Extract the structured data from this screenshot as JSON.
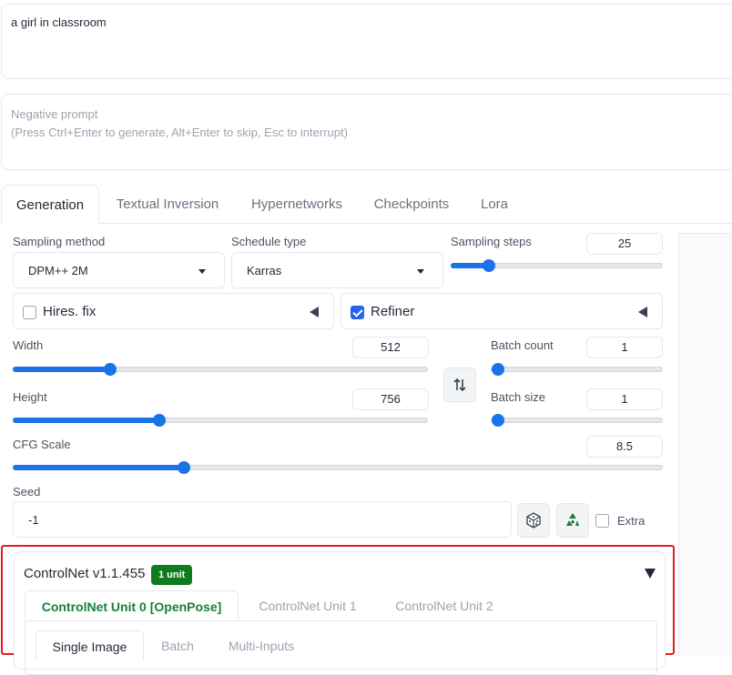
{
  "prompt": {
    "value": "a girl in classroom"
  },
  "negative_prompt": {
    "placeholder_line1": "Negative prompt",
    "placeholder_line2": "(Press Ctrl+Enter to generate, Alt+Enter to skip, Esc to interrupt)"
  },
  "tabs": [
    "Generation",
    "Textual Inversion",
    "Hypernetworks",
    "Checkpoints",
    "Lora"
  ],
  "sampling": {
    "method_label": "Sampling method",
    "method_value": "DPM++ 2M",
    "schedule_label": "Schedule type",
    "schedule_value": "Karras",
    "steps_label": "Sampling steps",
    "steps_value": "25",
    "steps_min": 1,
    "steps_max": 150
  },
  "hires": {
    "label": "Hires. fix",
    "checked": false
  },
  "refiner": {
    "label": "Refiner",
    "checked": true
  },
  "width": {
    "label": "Width",
    "value": "512",
    "min": 64,
    "max": 2048
  },
  "height": {
    "label": "Height",
    "value": "756",
    "min": 64,
    "max": 2048
  },
  "batch_count": {
    "label": "Batch count",
    "value": "1"
  },
  "batch_size": {
    "label": "Batch size",
    "value": "1"
  },
  "cfg": {
    "label": "CFG Scale",
    "value": "8.5",
    "min": 1,
    "max": 30
  },
  "seed": {
    "label": "Seed",
    "value": "-1",
    "extra_label": "Extra"
  },
  "controlnet": {
    "title": "ControlNet v1.1.455",
    "badge": "1 unit",
    "unit_tabs": [
      "ControlNet Unit 0 [OpenPose]",
      "ControlNet Unit 1",
      "ControlNet Unit 2"
    ],
    "input_tabs": [
      "Single Image",
      "Batch",
      "Multi-Inputs"
    ]
  },
  "colors": {
    "accent": "#1a73e8",
    "badge_bg": "#0f7a1f",
    "highlight": "#e11d1d"
  }
}
